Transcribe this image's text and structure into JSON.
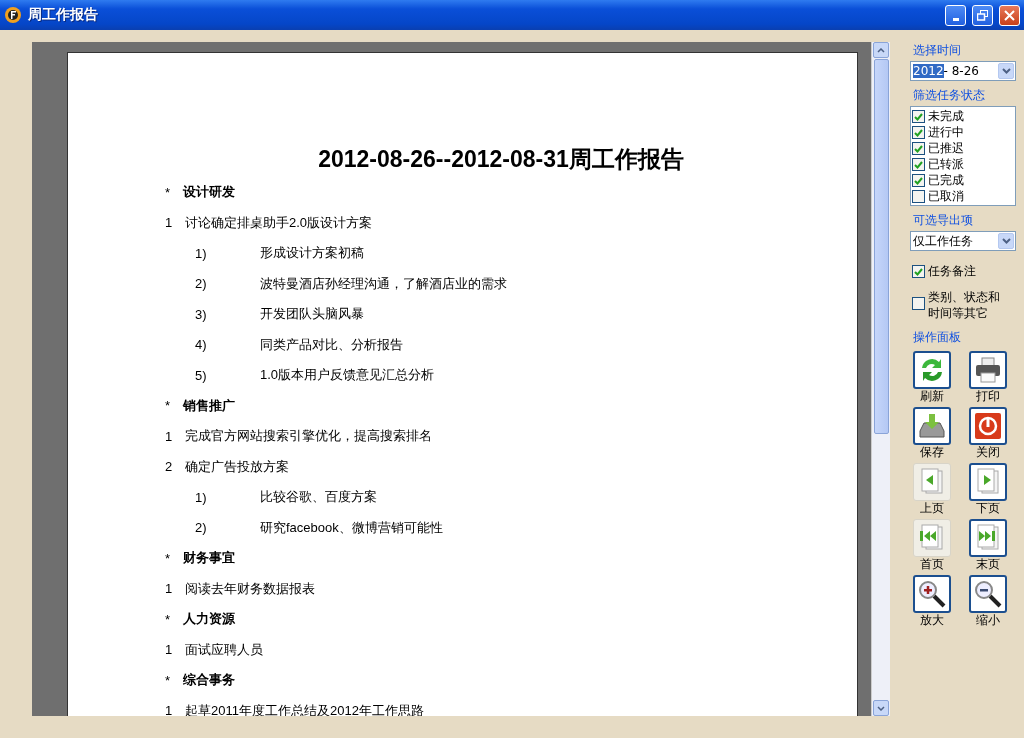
{
  "window": {
    "title": "周工作报告"
  },
  "report": {
    "title": "2012-08-26--2012-08-31周工作报告",
    "sections": [
      {
        "marker": "*",
        "heading": "设计研发",
        "items": [
          {
            "number": "1",
            "text": "讨论确定排桌助手2.0版设计方案",
            "children": [
              {
                "number": "1)",
                "text": "形成设计方案初稿"
              },
              {
                "number": "2)",
                "text": "波特曼酒店孙经理沟通，了解酒店业的需求"
              },
              {
                "number": "3)",
                "text": "开发团队头脑风暴"
              },
              {
                "number": "4)",
                "text": "同类产品对比、分析报告"
              },
              {
                "number": "5)",
                "text": "1.0版本用户反馈意见汇总分析"
              }
            ]
          }
        ]
      },
      {
        "marker": "*",
        "heading": "销售推广",
        "items": [
          {
            "number": "1",
            "text": "完成官方网站搜索引擎优化，提高搜索排名"
          },
          {
            "number": "2",
            "text": "确定广告投放方案",
            "children": [
              {
                "number": "1)",
                "text": "比较谷歌、百度方案"
              },
              {
                "number": "2)",
                "text": "研究facebook、微博营销可能性"
              }
            ]
          }
        ]
      },
      {
        "marker": "*",
        "heading": "财务事宜",
        "items": [
          {
            "number": "1",
            "text": "阅读去年财务数据报表"
          }
        ]
      },
      {
        "marker": "*",
        "heading": "人力资源",
        "items": [
          {
            "number": "1",
            "text": "面试应聘人员"
          }
        ]
      },
      {
        "marker": "*",
        "heading": "综合事务",
        "items": [
          {
            "number": "1",
            "text": "起草2011年度工作总结及2012年工作思路"
          }
        ]
      }
    ]
  },
  "panel": {
    "time_label": "选择时间",
    "date": {
      "selected_part": "2012",
      "rest": "- 8-26"
    },
    "status_label": "筛选任务状态",
    "statuses": [
      {
        "label": "未完成",
        "checked": true
      },
      {
        "label": "进行中",
        "checked": true
      },
      {
        "label": "已推迟",
        "checked": true
      },
      {
        "label": "已转派",
        "checked": true
      },
      {
        "label": "已完成",
        "checked": true
      },
      {
        "label": "已取消",
        "checked": false
      }
    ],
    "export_label": "可选导出项",
    "export_select": "仅工作任务",
    "export_options": [
      {
        "label": "任务备注",
        "checked": true
      },
      {
        "label": "类别、状态和时间等其它",
        "checked": false
      }
    ],
    "actions_label": "操作面板",
    "actions": [
      {
        "kind": "refresh",
        "label": "刷新",
        "disabled": false
      },
      {
        "kind": "print",
        "label": "打印",
        "disabled": false
      },
      {
        "kind": "save",
        "label": "保存",
        "disabled": false
      },
      {
        "kind": "close",
        "label": "关闭",
        "disabled": false
      },
      {
        "kind": "prev",
        "label": "上页",
        "disabled": true
      },
      {
        "kind": "next",
        "label": "下页",
        "disabled": false
      },
      {
        "kind": "first",
        "label": "首页",
        "disabled": true
      },
      {
        "kind": "last",
        "label": "末页",
        "disabled": false
      },
      {
        "kind": "zoom-in",
        "label": "放大",
        "disabled": false
      },
      {
        "kind": "zoom-out",
        "label": "缩小",
        "disabled": false
      }
    ]
  }
}
